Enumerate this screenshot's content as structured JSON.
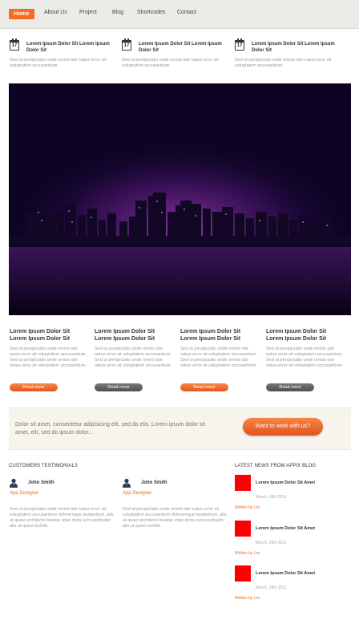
{
  "nav": {
    "items": [
      "Home",
      "About Us",
      "Project",
      "Blog",
      "Shortcodes",
      "Contact"
    ]
  },
  "events": [
    {
      "day": "17",
      "title": "Lorem Ipsum Dolor Sit Lorem Ipsum Dolor Sit",
      "desc": "Sed ut perspiciatis unde omnis iste natus error sit voluptatem accusantium."
    },
    {
      "day": "17",
      "title": "Lorem Ipsum Dolor Sit Lorem Ipsum Dolor Sit",
      "desc": "Sed ut perspiciatis unde omnis iste natus error sit voluptatem accusantium."
    },
    {
      "day": "17",
      "title": "Lorem Ipsum Dolor Sit Lorem Ipsum Dolor Sit",
      "desc": "Sed ut perspiciatis unde omnis iste natus error sit voluptatem accusantium."
    }
  ],
  "cards": [
    {
      "title": "Lorem Ipsum Dolor Sit Lorem Ipsum Dolor Sit",
      "desc": "Sed ut perspiciatis unde omnis iste natus error sit voluptatem accusantium. Sed ut perspiciatis unde omnis iste natus error sit voluptatem accusantium.",
      "button": "Read more"
    },
    {
      "title": "Lorem Ipsum Dolor Sit Lorem Ipsum Dolor Sit",
      "desc": "Sed ut perspiciatis unde omnis iste natus error sit voluptatem accusantium. Sed ut perspiciatis unde omnis iste natus error sit voluptatem accusantium.",
      "button": "Read more"
    },
    {
      "title": "Lorem Ipsum Dolor Sit Lorem Ipsum Dolor Sit",
      "desc": "Sed ut perspiciatis unde omnis iste natus error sit voluptatem accusantium. Sed ut perspiciatis unde omnis iste natus error sit voluptatem accusantium.",
      "button": "Read more"
    },
    {
      "title": "Lorem Ipsum Dolor Sit Lorem Ipsum Dolor Sit",
      "desc": "Sed ut perspiciatis unde omnis iste natus error sit voluptatem accusantium. Sed ut perspiciatis unde omnis iste natus error sit voluptatem accusantium.",
      "button": "Read more"
    }
  ],
  "cta": {
    "text": "Dolor sit amet, consectetur adipisicing elit, sed do elis. Lorem ipsum dolor sit amet, elit, sed do ipsum dolor...",
    "button": "Want to work with us?"
  },
  "testimonials": {
    "heading": "CUSTOMERS TESTIMONIALS",
    "items": [
      {
        "name": "John Smith",
        "role": "App Designer",
        "quote": "Sed ut perspiciatis unde omnis iste natus error sit voluptatem accusantium doloremque laudantium, alis ut quasi architecto beatae vitae dicta sunt explicabo alis ut quasi archite."
      },
      {
        "name": "John Smith",
        "role": "App Designer",
        "quote": "Sed ut perspiciatis unde omnis iste natus error sit voluptatem accusantium doloremque laudantium, alis ut quasi architecto beatae vitae dicta sunt explicabo alis ut quasi archite."
      }
    ]
  },
  "news": {
    "heading": "LATEST NEWS FROM APPIX BLOG",
    "items": [
      {
        "title": "Lorem Ipsum Dolor Sit Amet",
        "date": "March, 28th 2011",
        "author": "Written by Lirc"
      },
      {
        "title": "Lorem Ipsum Dolor Sit Amet",
        "date": "March, 28th 2011",
        "author": "Written by Lirc"
      },
      {
        "title": "Lorem Ipsum Dolor Sit Amet",
        "date": "March, 28th 2011",
        "author": "Written by Lirc"
      }
    ]
  },
  "colors": {
    "accent": "#f36c20",
    "thumb": "#ff0000",
    "hero": "#1a0838"
  },
  "icons": {
    "event": "calendar-icon",
    "avatar": "user-icon"
  }
}
